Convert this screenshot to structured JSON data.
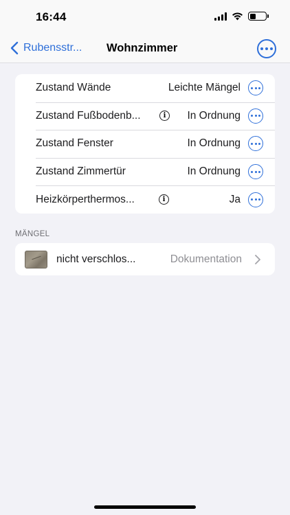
{
  "status_bar": {
    "time": "16:44",
    "icons": [
      "cellular-signal-icon",
      "wifi-icon",
      "battery-icon"
    ]
  },
  "nav": {
    "back_label": "Rubensstr...",
    "title": "Wohnzimmer",
    "more_icon": "ellipsis-circle-icon"
  },
  "properties": [
    {
      "label": "Zustand Wände",
      "value": "Leichte Mängel",
      "info": false
    },
    {
      "label": "Zustand Fußbodenb...",
      "value": "In Ordnung",
      "info": true
    },
    {
      "label": "Zustand Fenster",
      "value": "In Ordnung",
      "info": false
    },
    {
      "label": "Zustand Zimmertür",
      "value": "In Ordnung",
      "info": false
    },
    {
      "label": "Heizkörperthermos...",
      "value": "Ja",
      "info": true
    }
  ],
  "defects_section": {
    "header": "MÄNGEL",
    "items": [
      {
        "title": "nicht verschlos...",
        "value": "Dokumentation"
      }
    ]
  },
  "colors": {
    "accent": "#2e6fd9",
    "background": "#f2f2f7",
    "card": "#ffffff",
    "secondary_text": "#8e8e93"
  }
}
